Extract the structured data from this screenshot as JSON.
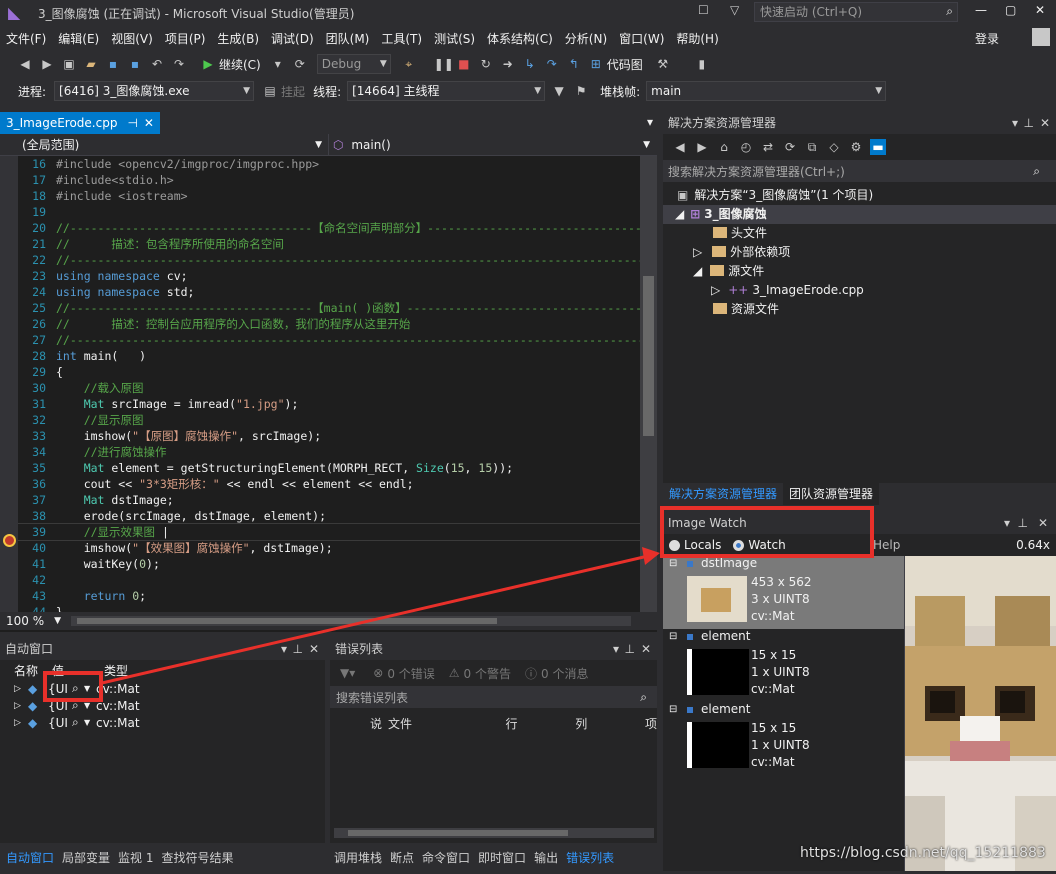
{
  "window": {
    "title": "3_图像腐蚀 (正在调试) - Microsoft Visual Studio(管理员)",
    "quick_launch": "快速启动 (Ctrl+Q)",
    "login": "登录"
  },
  "menu": [
    "文件(F)",
    "编辑(E)",
    "视图(V)",
    "项目(P)",
    "生成(B)",
    "调试(D)",
    "团队(M)",
    "工具(T)",
    "测试(S)",
    "体系结构(C)",
    "分析(N)",
    "窗口(W)",
    "帮助(H)"
  ],
  "toolbar": {
    "continue": "继续(C)",
    "config": "Debug",
    "codemap": "代码图"
  },
  "debugbar": {
    "process_label": "进程:",
    "process": "[6416] 3_图像腐蚀.exe",
    "suspend": "挂起",
    "thread_label": "线程:",
    "thread": "[14664] 主线程",
    "stack_label": "堆栈帧:",
    "stack": "main"
  },
  "editor": {
    "tab": "3_ImageErode.cpp",
    "scope": "(全局范围)",
    "func": "main()",
    "zoom": "100 %"
  },
  "code": [
    {
      "n": "16",
      "html": "<span class='pp'>#include &lt;opencv2/imgproc/imgproc.hpp&gt;</span>"
    },
    {
      "n": "17",
      "html": "<span class='pp'>#include&lt;stdio.h&gt;</span>"
    },
    {
      "n": "18",
      "html": "<span class='pp'>#include &lt;iostream&gt;</span>"
    },
    {
      "n": "19",
      "html": ""
    },
    {
      "n": "20",
      "html": "<span class='cmt'>//-----------------------------------【命名空间声明部分】---------------------------------------</span>"
    },
    {
      "n": "21",
      "html": "<span class='cmt'>//      描述：包含程序所使用的命名空间</span>"
    },
    {
      "n": "22",
      "html": "<span class='cmt'>//-----------------------------------------------------------------------------------------------</span>"
    },
    {
      "n": "23",
      "html": "<span class='kw'>using namespace</span> cv;"
    },
    {
      "n": "24",
      "html": "<span class='kw'>using namespace</span> std;"
    },
    {
      "n": "25",
      "html": "<span class='cmt'>//-----------------------------------【main( )函数】--------------------------------------------</span>"
    },
    {
      "n": "26",
      "html": "<span class='cmt'>//      描述：控制台应用程序的入口函数，我们的程序从这里开始</span>"
    },
    {
      "n": "27",
      "html": "<span class='cmt'>//-----------------------------------------------------------------------------------------------</span>"
    },
    {
      "n": "28",
      "html": "<span class='kw'>int</span> main(   )"
    },
    {
      "n": "29",
      "html": "{"
    },
    {
      "n": "30",
      "html": "    <span class='cmt'>//载入原图</span>"
    },
    {
      "n": "31",
      "html": "    <span class='typ'>Mat</span> srcImage = imread(<span class='str'>\"1.jpg\"</span>);"
    },
    {
      "n": "32",
      "html": "    <span class='cmt'>//显示原图</span>"
    },
    {
      "n": "33",
      "html": "    imshow(<span class='str'>\"【原图】腐蚀操作\"</span>, srcImage);"
    },
    {
      "n": "34",
      "html": "    <span class='cmt'>//进行腐蚀操作</span>"
    },
    {
      "n": "35",
      "html": "    <span class='typ'>Mat</span> element = getStructuringElement(MORPH_RECT, <span class='typ'>Size</span>(<span class='num'>15</span>, <span class='num'>15</span>));"
    },
    {
      "n": "36",
      "html": "    cout &lt;&lt; <span class='str'>\"3*3矩形核：\"</span> &lt;&lt; endl &lt;&lt; element &lt;&lt; endl;"
    },
    {
      "n": "37",
      "html": "    <span class='typ'>Mat</span> dstImage;"
    },
    {
      "n": "38",
      "html": "    erode(srcImage, dstImage, element);"
    },
    {
      "n": "39",
      "html": "    <span class='cmt'>//显示效果图</span> |"
    },
    {
      "n": "40",
      "html": "    imshow(<span class='str'>\"【效果图】腐蚀操作\"</span>, dstImage);"
    },
    {
      "n": "41",
      "html": "    waitKey(<span class='num'>0</span>);"
    },
    {
      "n": "42",
      "html": ""
    },
    {
      "n": "43",
      "html": "    <span class='kw'>return</span> <span class='num'>0</span>;"
    },
    {
      "n": "44",
      "html": "}"
    }
  ],
  "auto": {
    "title": "自动窗口",
    "cols": [
      "名称",
      "值",
      "类型"
    ],
    "rows": [
      {
        "val": "{UI",
        "type": "cv::Mat"
      },
      {
        "val": "{UI",
        "type": "cv::Mat"
      },
      {
        "val": "{UI",
        "type": "cv::Mat"
      }
    ]
  },
  "errors": {
    "title": "错误列表",
    "errors": "0 个错误",
    "warnings": "0 个警告",
    "messages": "0 个消息",
    "search": "搜索错误列表",
    "cols": [
      "说",
      "文件",
      "行",
      "列",
      "项"
    ]
  },
  "bottom_tabs_left": [
    "自动窗口",
    "局部变量",
    "监视 1",
    "查找符号结果"
  ],
  "bottom_tabs_right": [
    "调用堆栈",
    "断点",
    "命令窗口",
    "即时窗口",
    "输出",
    "错误列表"
  ],
  "solution": {
    "title": "解决方案资源管理器",
    "search": "搜索解决方案资源管理器(Ctrl+;)",
    "root": "解决方案“3_图像腐蚀”(1 个项目)",
    "project": "3_图像腐蚀",
    "headers": "头文件",
    "external": "外部依赖项",
    "sources": "源文件",
    "cpp": "3_ImageErode.cpp",
    "resources": "资源文件",
    "tab1": "解决方案资源管理器",
    "tab2": "团队资源管理器"
  },
  "imagewatch": {
    "title": "Image Watch",
    "locals": "Locals",
    "watch": "Watch",
    "help": "Help",
    "zoom": "0.64x",
    "items": [
      {
        "name": "dstImage",
        "size": "453 x 562",
        "fmt": "3 x UINT8",
        "type": "cv::Mat"
      },
      {
        "name": "element",
        "size": "15 x 15",
        "fmt": "1 x UINT8",
        "type": "cv::Mat"
      },
      {
        "name": "element",
        "size": "15 x 15",
        "fmt": "1 x UINT8",
        "type": "cv::Mat"
      }
    ]
  },
  "watermark": "https://blog.csdn.net/qq_15211883"
}
